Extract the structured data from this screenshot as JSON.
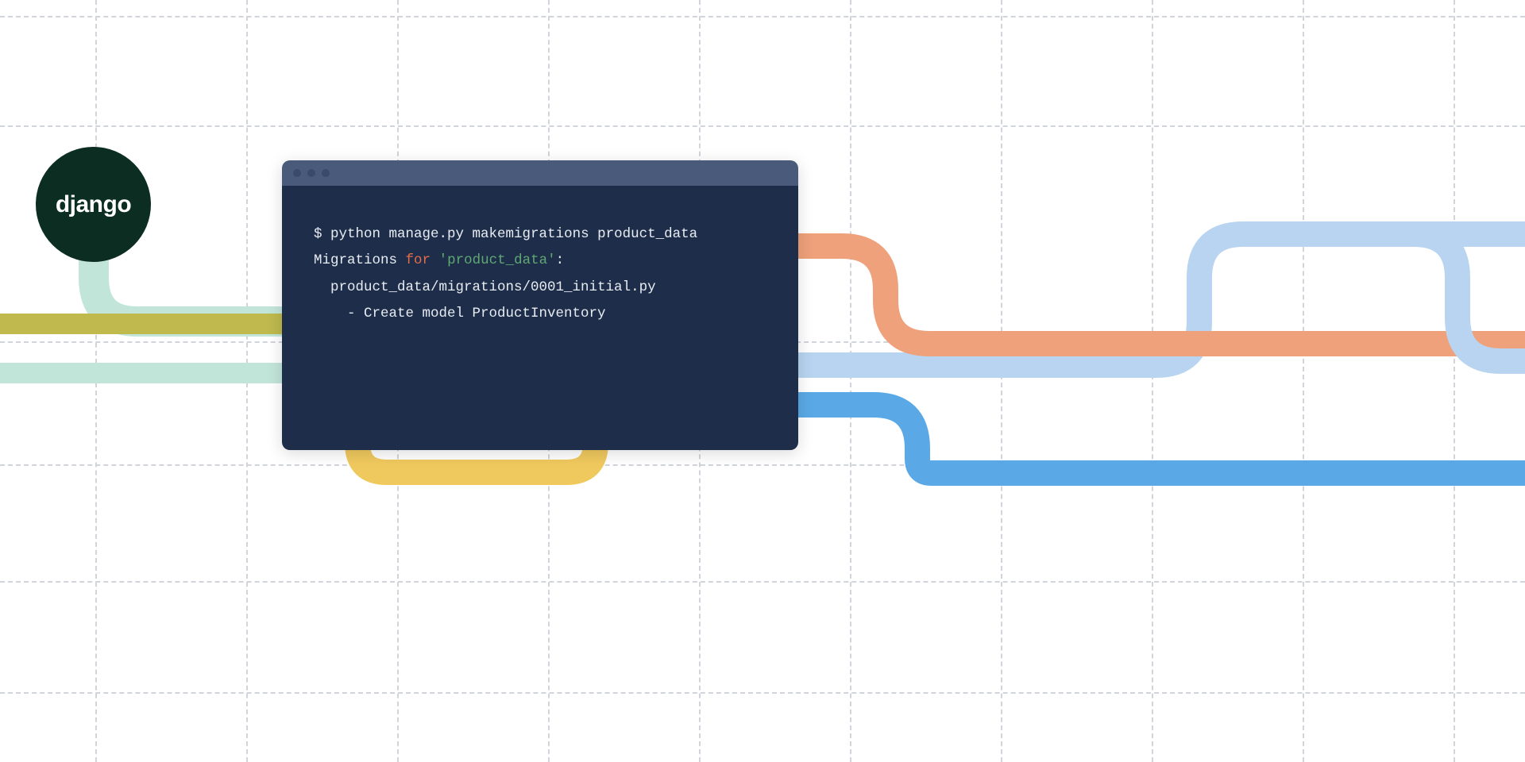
{
  "badge": {
    "label": "django"
  },
  "terminal": {
    "line1_prompt": "$ ",
    "line1_cmd": "python manage.py makemigrations product_data",
    "line2_pre": "Migrations ",
    "line2_for": "for",
    "line2_sp": " ",
    "line2_str": "'product_data'",
    "line2_post": ":",
    "line3": "  product_data/migrations/0001_initial.py",
    "line4": "    - Create model ProductInventory"
  },
  "colors": {
    "mint": "#c2e5da",
    "olive": "#bfb94e",
    "yellow": "#f0c95e",
    "orange": "#eea17a",
    "lightblue": "#b8d4f0",
    "blue": "#5aa9e6",
    "terminal_bg": "#1e2e4a",
    "terminal_bar": "#4a5a7a",
    "badge_bg": "#0c2e22"
  }
}
